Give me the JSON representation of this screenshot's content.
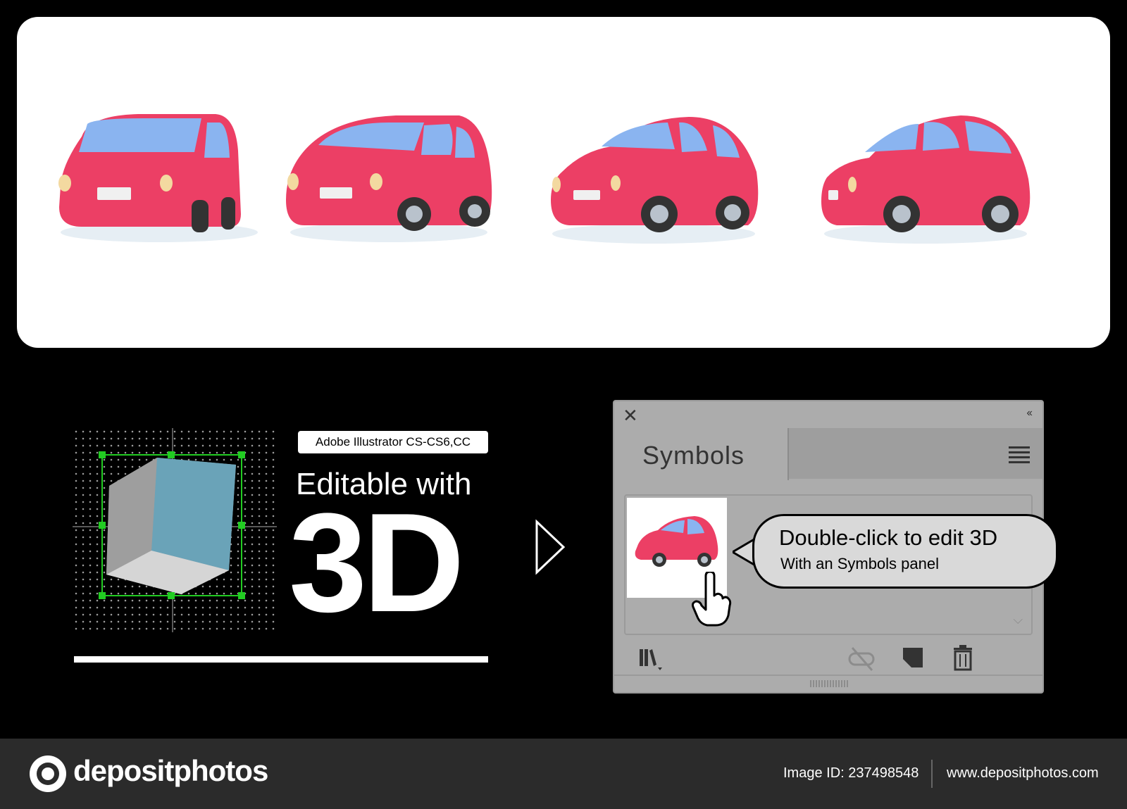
{
  "badge": {
    "label": "Adobe Illustrator CS-CS6,CC"
  },
  "headline": {
    "line1": "Editable with",
    "big": "3D"
  },
  "symbols_panel": {
    "close_glyph": "✕",
    "collapse_glyph": "‹‹",
    "tab_label": "Symbols",
    "callout_title": "Double-click to edit 3D",
    "callout_subtitle": "With an Symbols panel",
    "footer_icons": [
      "library-icon",
      "break-link-icon",
      "new-symbol-icon",
      "trash-icon"
    ]
  },
  "footer": {
    "brand": "depositphotos",
    "image_id": "Image ID: 237498548",
    "site": "www.depositphotos.com"
  },
  "colors": {
    "car_body": "#ec3f65",
    "car_glass": "#8ab4f0",
    "cube_face": "#6aa3b8",
    "selection": "#22cc22",
    "panel_bg": "#acacac",
    "footer_bg": "#2b2b2b"
  }
}
